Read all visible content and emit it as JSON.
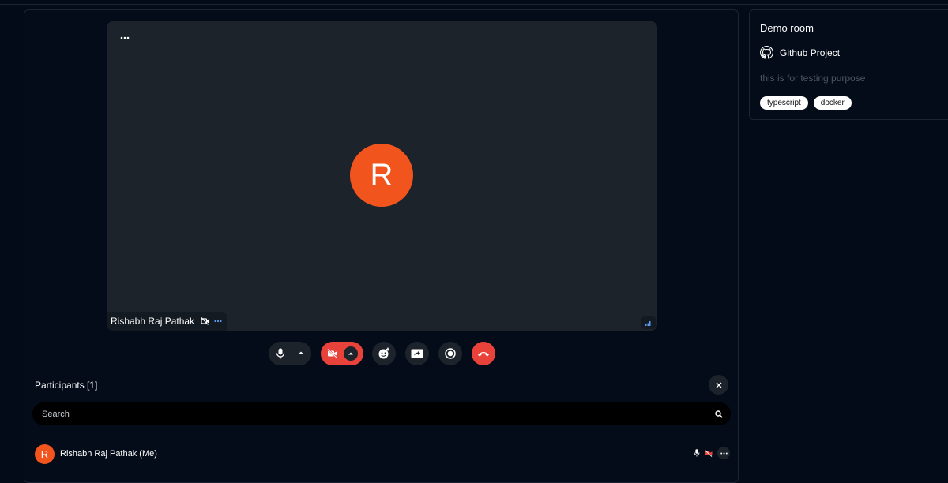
{
  "video": {
    "participant_initial": "R",
    "participant_name": "Rishabh Raj Pathak"
  },
  "participants": {
    "title": "Participants [1]",
    "search_placeholder": "Search",
    "list": [
      {
        "initial": "R",
        "name": "Rishabh Raj Pathak (Me)"
      }
    ]
  },
  "room": {
    "title": "Demo room",
    "github_label": "Github Project",
    "description": "this is for testing purpose",
    "tags": [
      "typescript",
      "docker"
    ]
  },
  "colors": {
    "avatar": "#f2541e",
    "danger": "#e8423a",
    "tile": "#1d232b",
    "background": "#040b18"
  },
  "icons": {
    "tile_menu": "more-horizontal-icon",
    "camera_off": "camera-off-icon",
    "signal": "signal-bars-icon",
    "mic": "microphone-icon",
    "caret": "chevron-up-icon",
    "emoji": "emoji-add-icon",
    "share": "screen-share-icon",
    "record": "record-icon",
    "leave": "phone-hangup-icon",
    "close": "close-icon",
    "search": "search-icon",
    "github": "github-icon"
  }
}
